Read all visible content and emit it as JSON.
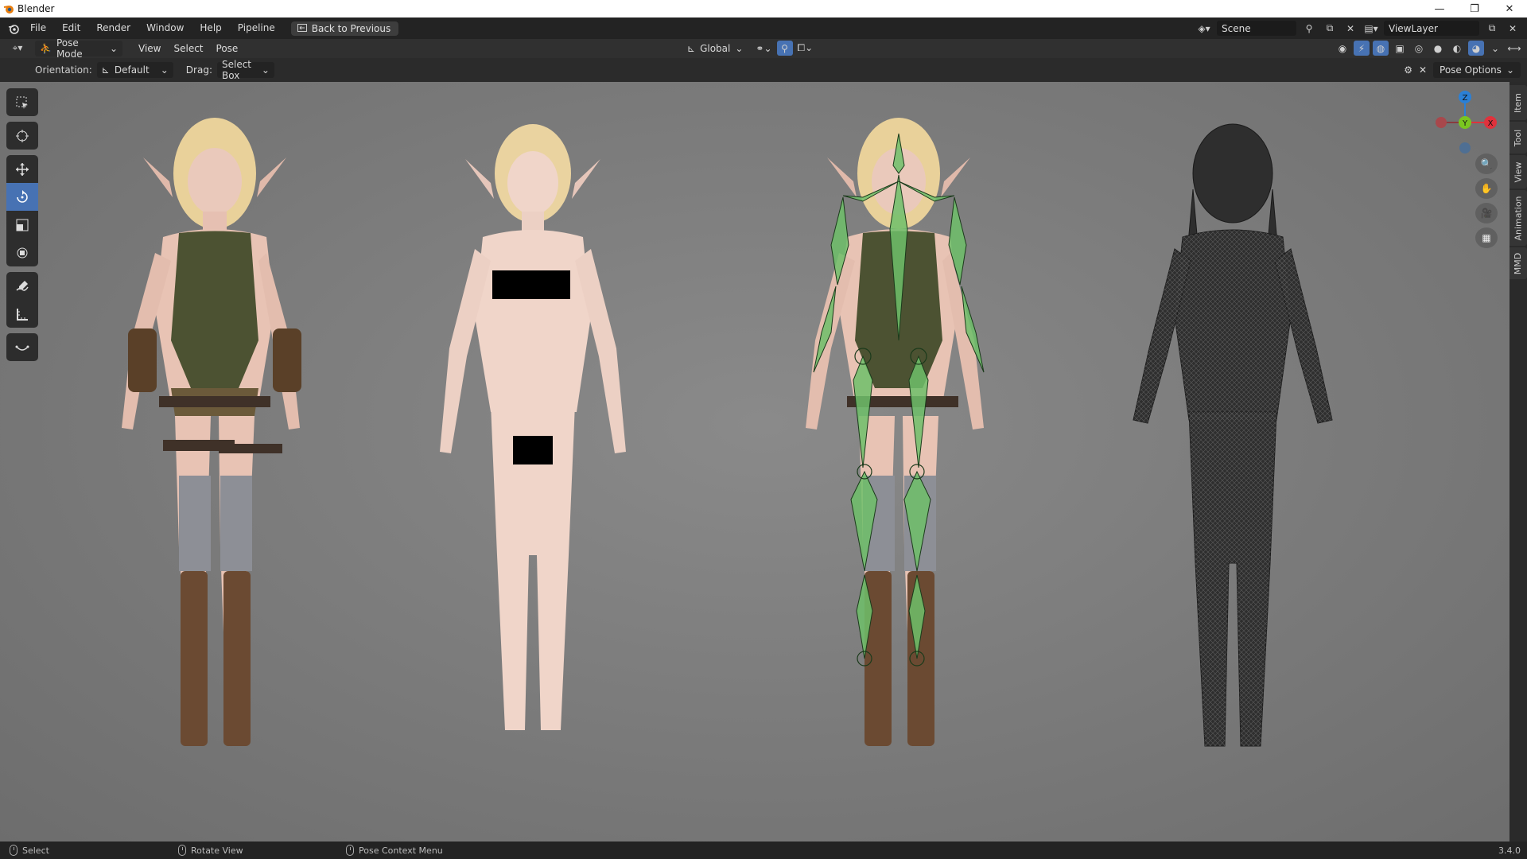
{
  "window": {
    "title": "Blender",
    "controls": [
      "minimize",
      "restore",
      "close"
    ]
  },
  "topbar": {
    "menus": [
      "File",
      "Edit",
      "Render",
      "Window",
      "Help",
      "Pipeline"
    ],
    "back_button": "Back to Previous",
    "scene": "Scene",
    "view_layer": "ViewLayer"
  },
  "header": {
    "mode": "Pose Mode",
    "menus": [
      "View",
      "Select",
      "Pose"
    ],
    "transform_orientation": "Global"
  },
  "tool_settings": {
    "orientation_label": "Orientation:",
    "orientation_value": "Default",
    "drag_label": "Drag:",
    "drag_value": "Select Box",
    "pose_options": "Pose Options"
  },
  "toolbar": {
    "tools": [
      "select-box-icon",
      "cursor-icon",
      "move-icon",
      "rotate-icon",
      "scale-icon",
      "transform-icon",
      "annotate-icon",
      "measure-icon",
      "bone-roll-icon"
    ],
    "active": "rotate-icon"
  },
  "gizmo": {
    "axes": [
      "Z",
      "Y",
      "X"
    ],
    "colors": {
      "x": "#e0323c",
      "y": "#7ac620",
      "z": "#2b80d6"
    }
  },
  "sidebar_tabs": [
    "Item",
    "Tool",
    "View",
    "Animation",
    "MMD"
  ],
  "statusbar": {
    "left": "Select",
    "middle": "Rotate View",
    "right": "Pose Context Menu",
    "version": "3.4.0"
  },
  "colors": {
    "accent": "#4772b3",
    "bone_green": "#6fbf6a"
  }
}
